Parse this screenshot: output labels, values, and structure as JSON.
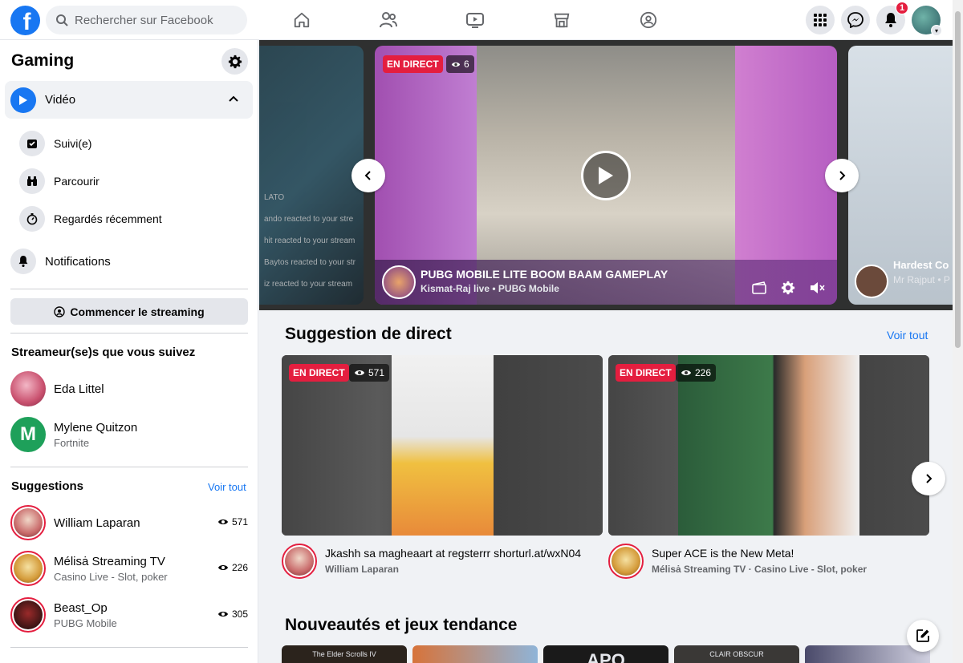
{
  "topbar": {
    "logo_letter": "f",
    "search_placeholder": "Rechercher sur Facebook",
    "notifications_count": "1"
  },
  "sidebar": {
    "title": "Gaming",
    "video_label": "Vidéo",
    "sub_items": [
      {
        "label": "Suivi(e)",
        "icon": "followed-icon"
      },
      {
        "label": "Parcourir",
        "icon": "binoculars-icon"
      },
      {
        "label": "Regardés récemment",
        "icon": "stopwatch-icon"
      }
    ],
    "notifications_label": "Notifications",
    "stream_button": "Commencer le streaming",
    "followed_title": "Streameur(se)s que vous suivez",
    "followed": [
      {
        "name": "Eda Littel",
        "sub": ""
      },
      {
        "name": "Mylene Quitzon",
        "sub": "Fortnite",
        "initial": "M"
      }
    ],
    "suggestions_title": "Suggestions",
    "suggestions_see_all": "Voir tout",
    "suggestions": [
      {
        "name": "William Laparan",
        "sub": "",
        "views": "571"
      },
      {
        "name": "Mélisȧ Streaming TV",
        "sub": "Casino Live - Slot, poker",
        "views": "226"
      },
      {
        "name": "Beast_Op",
        "sub": "PUBG Mobile",
        "views": "305"
      }
    ]
  },
  "hero": {
    "live_label": "EN DIRECT",
    "viewers": "6",
    "title": "PUBG MOBILE LITE BOOM BAAM GAMEPLAY",
    "subtitle": "Kismat-Raj live • PUBG Mobile",
    "right_title": "Hardest Co",
    "right_sub": "Mr Rajput • P",
    "left_lines": [
      "LATO",
      "ando reacted to your stre",
      "hit reacted to your stream",
      "Baytos reacted to your str",
      "iz reacted to your stream"
    ]
  },
  "suggested": {
    "heading": "Suggestion de direct",
    "see_all": "Voir tout",
    "cards": [
      {
        "live": "EN DIRECT",
        "viewers": "571",
        "title": "Jkashh sa magheaart at regsterrr shorturl.at/wxN04",
        "sub": "William Laparan"
      },
      {
        "live": "EN DIRECT",
        "viewers": "226",
        "title": "Super ACE is the New Meta!",
        "sub": "Mélisȧ Streaming TV · Casino Live - Slot, poker"
      }
    ]
  },
  "trending": {
    "heading": "Nouveautés et jeux tendance",
    "tiles": [
      "The Elder Scrolls IV",
      "",
      "APO",
      "CLAIR OBSCUR",
      ""
    ]
  },
  "colors": {
    "brand": "#1877f2",
    "live": "#e41e3f"
  }
}
